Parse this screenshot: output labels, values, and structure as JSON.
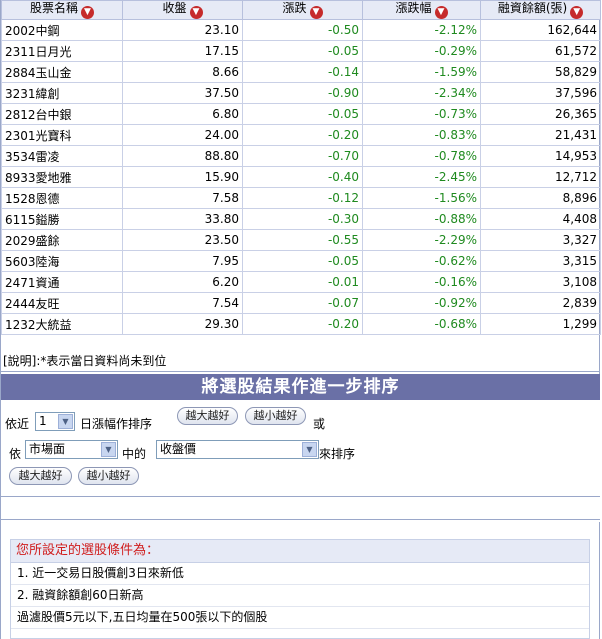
{
  "table": {
    "headers": [
      "股票名稱",
      "收盤",
      "漲跌",
      "漲跌幅",
      "融資餘額(張)"
    ],
    "rows": [
      {
        "name": "2002中鋼",
        "close": "23.10",
        "change": "-0.50",
        "pct": "-2.12%",
        "margin": "162,644"
      },
      {
        "name": "2311日月光",
        "close": "17.15",
        "change": "-0.05",
        "pct": "-0.29%",
        "margin": "61,572"
      },
      {
        "name": "2884玉山金",
        "close": "8.66",
        "change": "-0.14",
        "pct": "-1.59%",
        "margin": "58,829"
      },
      {
        "name": "3231緯創",
        "close": "37.50",
        "change": "-0.90",
        "pct": "-2.34%",
        "margin": "37,596"
      },
      {
        "name": "2812台中銀",
        "close": "6.80",
        "change": "-0.05",
        "pct": "-0.73%",
        "margin": "26,365"
      },
      {
        "name": "2301光寶科",
        "close": "24.00",
        "change": "-0.20",
        "pct": "-0.83%",
        "margin": "21,431"
      },
      {
        "name": "3534雷凌",
        "close": "88.80",
        "change": "-0.70",
        "pct": "-0.78%",
        "margin": "14,953"
      },
      {
        "name": "8933愛地雅",
        "close": "15.90",
        "change": "-0.40",
        "pct": "-2.45%",
        "margin": "12,712"
      },
      {
        "name": "1528恩德",
        "close": "7.58",
        "change": "-0.12",
        "pct": "-1.56%",
        "margin": "8,896"
      },
      {
        "name": "6115鎰勝",
        "close": "33.80",
        "change": "-0.30",
        "pct": "-0.88%",
        "margin": "4,408"
      },
      {
        "name": "2029盛餘",
        "close": "23.50",
        "change": "-0.55",
        "pct": "-2.29%",
        "margin": "3,327"
      },
      {
        "name": "5603陸海",
        "close": "7.95",
        "change": "-0.05",
        "pct": "-0.62%",
        "margin": "3,315"
      },
      {
        "name": "2471資通",
        "close": "6.20",
        "change": "-0.01",
        "pct": "-0.16%",
        "margin": "3,108"
      },
      {
        "name": "2444友旺",
        "close": "7.54",
        "change": "-0.07",
        "pct": "-0.92%",
        "margin": "2,839"
      },
      {
        "name": "1232大統益",
        "close": "29.30",
        "change": "-0.20",
        "pct": "-0.68%",
        "margin": "1,299"
      }
    ],
    "sort_icon": "sort-down-icon"
  },
  "note": "[說明]:*表示當日資料尚未到位",
  "sort_section": {
    "title": "將選股結果作進一步排序",
    "row1_prefix": "依近",
    "days_value": "1",
    "row1_suffix": "日漲幅作排序",
    "btn_desc": "越大越好",
    "btn_asc": "越小越好",
    "or": "或",
    "row2_prefix": "依",
    "market_value": "市場面",
    "middle": "中的",
    "field_value": "收盤價",
    "row2_suffix": "來排序"
  },
  "criteria": {
    "heading": "您所設定的選股條件為：",
    "items": [
      "1. 近一交易日股價創3日來新低",
      "2. 融資餘額創60日新高",
      "過濾股價5元以下,五日均量在500張以下的個股"
    ]
  },
  "colors": {
    "header_bg": "#e6eaf6",
    "bar_bg": "#6a70a6",
    "negative": "#1f8a1f",
    "icon_red": "#c62b2b",
    "criteria_heading": "#d01e1e"
  }
}
